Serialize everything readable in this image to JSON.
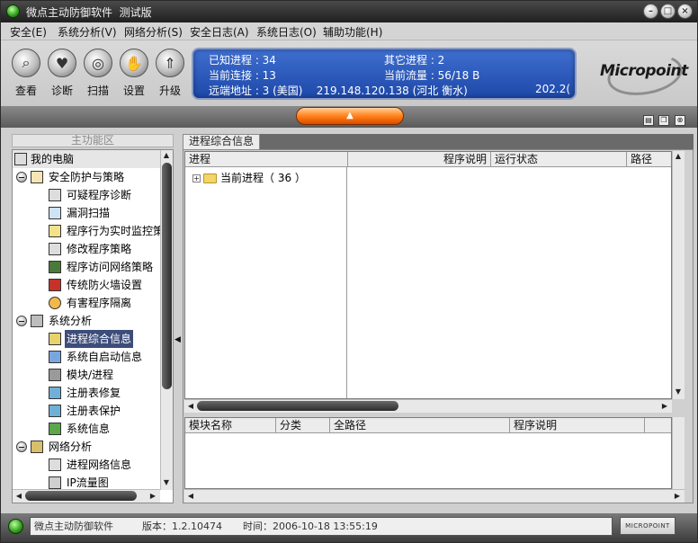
{
  "window": {
    "title": "微点主动防御软件  测试版"
  },
  "menu": [
    {
      "label": "安全(E)"
    },
    {
      "label": "系统分析(V)"
    },
    {
      "label": "网络分析(S)"
    },
    {
      "label": "安全日志(A)"
    },
    {
      "label": "系统日志(O)"
    },
    {
      "label": "辅助功能(H)"
    }
  ],
  "toolbar": [
    {
      "label": "查看",
      "icon": "magnifier-icon"
    },
    {
      "label": "诊断",
      "icon": "heart-pulse-icon"
    },
    {
      "label": "扫描",
      "icon": "radar-icon"
    },
    {
      "label": "设置",
      "icon": "hand-icon"
    },
    {
      "label": "升级",
      "icon": "upgrade-icon"
    }
  ],
  "info": {
    "known_processes": "已知进程 : 34",
    "other_processes": "其它进程 : 2",
    "current_connections": "当前连接 : 13",
    "current_traffic": "当前流量 : 56/18 B",
    "remote_address": "远端地址 : 3 (美国)    219.148.120.138 (河北 衡水)",
    "remote_trailing": "202.2("
  },
  "logo": {
    "text": "Micropoint"
  },
  "left_panel": {
    "header": "主功能区",
    "items": [
      {
        "label": "我的电脑",
        "icon": "computer-icon",
        "level": 0,
        "root": true
      },
      {
        "label": "安全防护与策略",
        "icon": "flag-icon",
        "level": 1,
        "group": true
      },
      {
        "label": "可疑程序诊断",
        "icon": "document-search-icon",
        "level": 2
      },
      {
        "label": "漏洞扫描",
        "icon": "magnifier-icon",
        "level": 2
      },
      {
        "label": "程序行为实时监控策",
        "icon": "clock-monitor-icon",
        "level": 2
      },
      {
        "label": "修改程序策略",
        "icon": "document-edit-icon",
        "level": 2
      },
      {
        "label": "程序访问网络策略",
        "icon": "network-window-icon",
        "level": 2
      },
      {
        "label": "传统防火墙设置",
        "icon": "firewall-icon",
        "level": 2
      },
      {
        "label": "有害程序隔离",
        "icon": "biohazard-icon",
        "level": 2
      },
      {
        "label": "系统分析",
        "icon": "system-window-icon",
        "level": 1,
        "group": true
      },
      {
        "label": "进程综合信息",
        "icon": "process-list-icon",
        "level": 2,
        "selected": true
      },
      {
        "label": "系统自启动信息",
        "icon": "startup-icon",
        "level": 2
      },
      {
        "label": "模块/进程",
        "icon": "module-icon",
        "level": 2
      },
      {
        "label": "注册表修复",
        "icon": "registry-repair-icon",
        "level": 2
      },
      {
        "label": "注册表保护",
        "icon": "registry-protect-icon",
        "level": 2
      },
      {
        "label": "系统信息",
        "icon": "system-info-icon",
        "level": 2
      },
      {
        "label": "网络分析",
        "icon": "network-icon",
        "level": 1,
        "group": true
      },
      {
        "label": "进程网络信息",
        "icon": "process-network-icon",
        "level": 2
      },
      {
        "label": "IP流量图",
        "icon": "traffic-chart-icon",
        "level": 2
      }
    ]
  },
  "right_panel": {
    "tab": "进程综合信息",
    "top_grid": {
      "columns": [
        "进程",
        "程序说明",
        "运行状态",
        "路径"
      ],
      "node": "当前进程（ 36 ）"
    },
    "bottom_grid": {
      "columns": [
        "模块名称",
        "分类",
        "全路径",
        "程序说明"
      ]
    }
  },
  "status": {
    "app": "微点主动防御软件",
    "version": "版本：1.2.10474",
    "time": "时间：2006-10-18 13:55:19",
    "logo": "MICROPOINT"
  },
  "colors": {
    "info_panel": "#2a56b8",
    "selection": "#3c4d7a",
    "accent_orange": "#ff7b12",
    "status_green": "#2f9b1c"
  }
}
